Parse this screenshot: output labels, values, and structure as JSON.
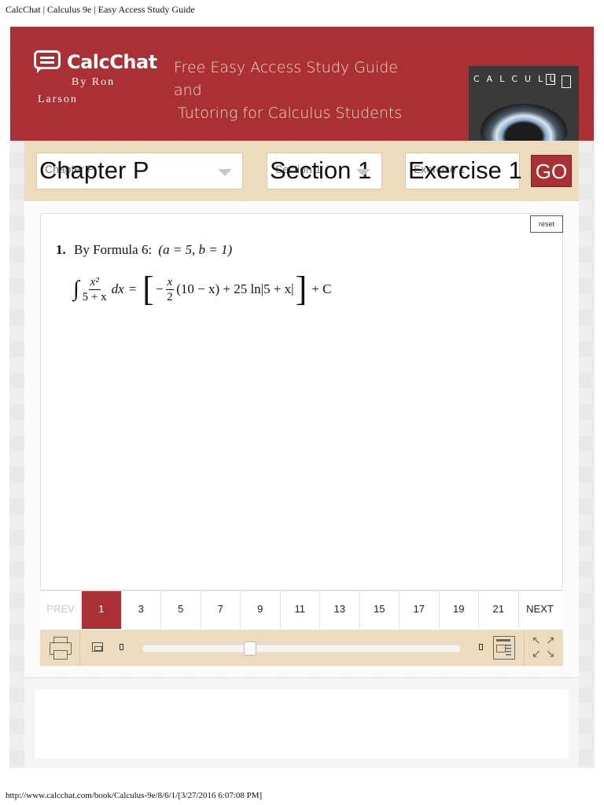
{
  "page": {
    "doc_title": "CalcChat | Calculus 9e | Easy Access Study Guide",
    "footer_url": "http://www.calcchat.com/book/Calculus-9e/8/6/1/[3/27/2016 6:07:08 PM]"
  },
  "header": {
    "logo_text": "CalcChat",
    "by_label": "By Ron",
    "author_last": "Larson",
    "tagline_line1": "Free Easy Access Study Guide and",
    "tagline_line2": "Tutoring for Calculus Students",
    "book_title": "CALCULUS",
    "brand_color": "#a93136"
  },
  "selectors": {
    "chapter": {
      "ghost": "Chapter P",
      "value": "Chapter P"
    },
    "section": {
      "ghost": "Section 1",
      "value": "Section 1"
    },
    "exercise": {
      "ghost": "Exercise 1",
      "value": "Exercise 1"
    },
    "go_label": "GO"
  },
  "viewer": {
    "reset_label": "reset",
    "solution": {
      "number": "1.",
      "intro": "By Formula 6:",
      "params": "(a = 5, b = 1)",
      "lhs_num": "x²",
      "lhs_den": "5 + x",
      "dx": "dx",
      "eq": "=",
      "minus": "−",
      "inner_num": "x",
      "inner_den": "2",
      "body": "(10 − x) + 25 ln|5 + x|",
      "tail": "+ C"
    }
  },
  "pager": {
    "prev_label": "PREV",
    "pages": [
      "1",
      "3",
      "5",
      "7",
      "9",
      "11",
      "13",
      "15",
      "17",
      "19",
      "21"
    ],
    "active_page": "1",
    "next_label": "NEXT"
  },
  "toolbar": {
    "icons": [
      "print-icon",
      "zoom-out-icon",
      "zoom-slider",
      "zoom-in-icon",
      "fullscreen-icon"
    ],
    "zoom_level": 0.33
  }
}
